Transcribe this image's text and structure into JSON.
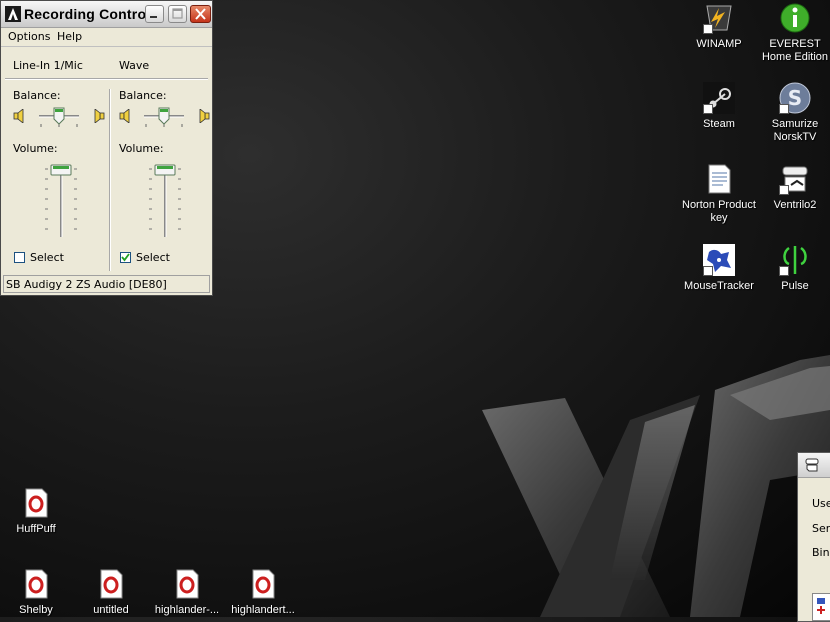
{
  "window": {
    "title": "Recording Control",
    "menu": [
      "Options",
      "Help"
    ],
    "channels": [
      {
        "name": "Line-In 1/Mic",
        "balance_label": "Balance:",
        "volume_label": "Volume:",
        "select_label": "Select",
        "selected": false,
        "volume": 0.95,
        "balance": 0.5
      },
      {
        "name": "Wave",
        "balance_label": "Balance:",
        "volume_label": "Volume:",
        "select_label": "Select",
        "selected": true,
        "volume": 0.95,
        "balance": 0.5
      }
    ],
    "status": "SB Audigy 2 ZS Audio [DE80]"
  },
  "desktop_icons": [
    {
      "label": "WINAMP",
      "icon": "winamp-icon"
    },
    {
      "label": "EVEREST Home Edition",
      "icon": "everest-icon"
    },
    {
      "label": "Steam",
      "icon": "steam-icon"
    },
    {
      "label": "Samurize NorskTV",
      "icon": "samurize-icon"
    },
    {
      "label": "Norton Product key",
      "icon": "text-file-icon"
    },
    {
      "label": "Ventrilo2",
      "icon": "ventrilo-icon"
    },
    {
      "label": "MouseTracker",
      "icon": "mousetracker-icon"
    },
    {
      "label": "Pulse",
      "icon": "pulse-icon"
    },
    {
      "label": "HuffPuff",
      "icon": "opera-file-icon"
    },
    {
      "label": "Shelby",
      "icon": "opera-file-icon"
    },
    {
      "label": "untitled",
      "icon": "opera-file-icon"
    },
    {
      "label": "highlander-...",
      "icon": "opera-file-icon"
    },
    {
      "label": "highlandert...",
      "icon": "opera-file-icon"
    }
  ],
  "partial_window": {
    "rows": [
      "Use",
      "Serv",
      "Bind"
    ]
  },
  "colors": {
    "window_bg": "#ece9d8",
    "check_blue": "#1c5180",
    "slider_green": "#3fa33f"
  }
}
